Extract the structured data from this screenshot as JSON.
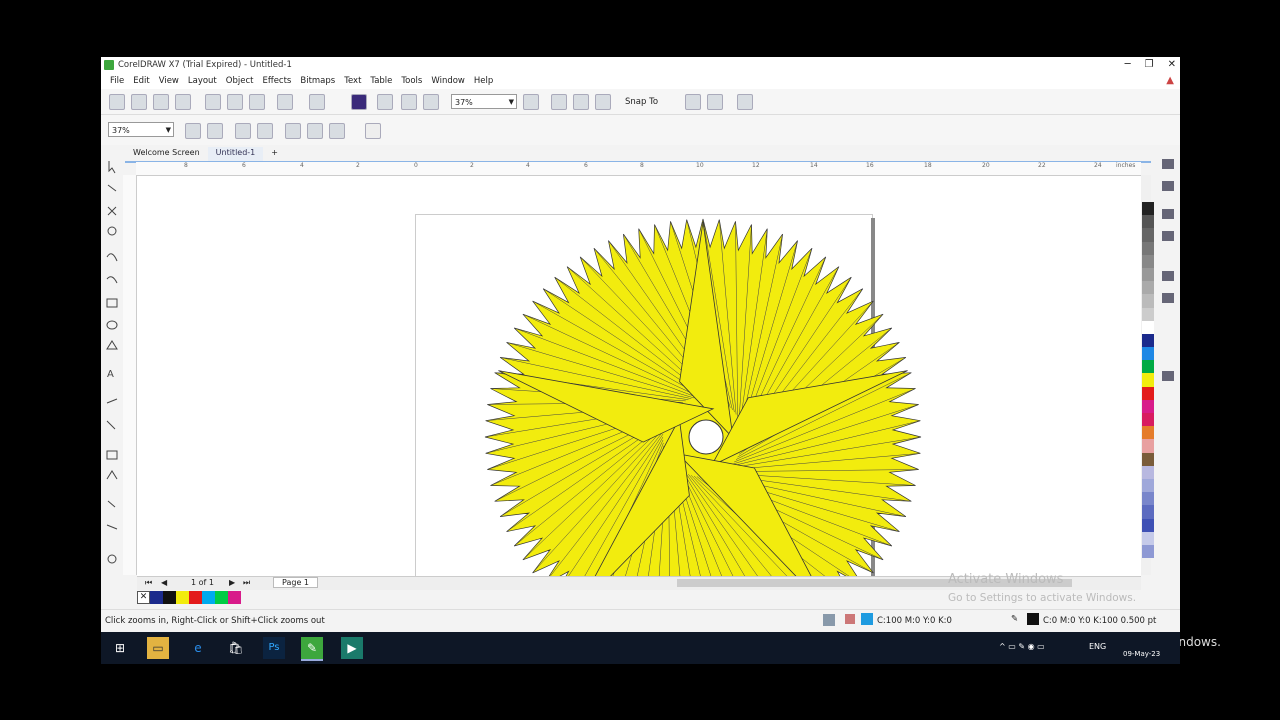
{
  "window": {
    "title": "CorelDRAW X7 (Trial Expired) - Untitled-1",
    "controls": [
      "─",
      "❐",
      "✕"
    ]
  },
  "menu": [
    "File",
    "Edit",
    "View",
    "Layout",
    "Object",
    "Effects",
    "Bitmaps",
    "Text",
    "Table",
    "Tools",
    "Window",
    "Help"
  ],
  "toolbar": {
    "zoom_value": "37%",
    "snap_to": "Snap To",
    "zoom_value_2": "37%"
  },
  "tabs": [
    "Welcome Screen",
    "Untitled-1"
  ],
  "ruler": {
    "h_ticks": [
      "8",
      "6",
      "4",
      "2",
      "0",
      "2",
      "4",
      "6",
      "8",
      "10",
      "12",
      "14",
      "16",
      "18",
      "20",
      "22",
      "24"
    ],
    "units": "inches"
  },
  "page_nav": {
    "page_count": "1 of 1",
    "page_tab": "Page 1"
  },
  "status": {
    "hint": "Click zooms in, Right-Click or Shift+Click zooms out",
    "fill": "C:100 M:0 Y:0 K:0",
    "outline": "C:0 M:0 Y:0 K:100  0.500 pt"
  },
  "watermark": {
    "line1": "Activate Windows",
    "line2": "Go to Settings to activate Windows.",
    "overlay": "Go to Settings to activate Windows."
  },
  "taskbar": {
    "lang": "ENG",
    "date": "09-May-23"
  },
  "colors": {
    "star_fill": "#f2ec0e",
    "palette": [
      "#222222",
      "#555555",
      "#666666",
      "#777777",
      "#888888",
      "#999999",
      "#aaaaaa",
      "#bbbbbb",
      "#cccccc",
      "#ffffff",
      "#1b2a8c",
      "#1e88e5",
      "#00aa44",
      "#f2ec0e",
      "#e31b1b",
      "#d81b8a",
      "#d81b60",
      "#e57c2b",
      "#e8a0a0",
      "#7a5c3a",
      "#b8b8e0",
      "#9fa8da",
      "#7986cb",
      "#5c6bc0",
      "#3f51b5",
      "#c5cae9",
      "#8e99d4"
    ],
    "doc_palette": [
      "#1b2a8c",
      "#111111",
      "#f2ec0e",
      "#e31b1b",
      "#00aaee",
      "#00cc44",
      "#d81b8a"
    ]
  }
}
